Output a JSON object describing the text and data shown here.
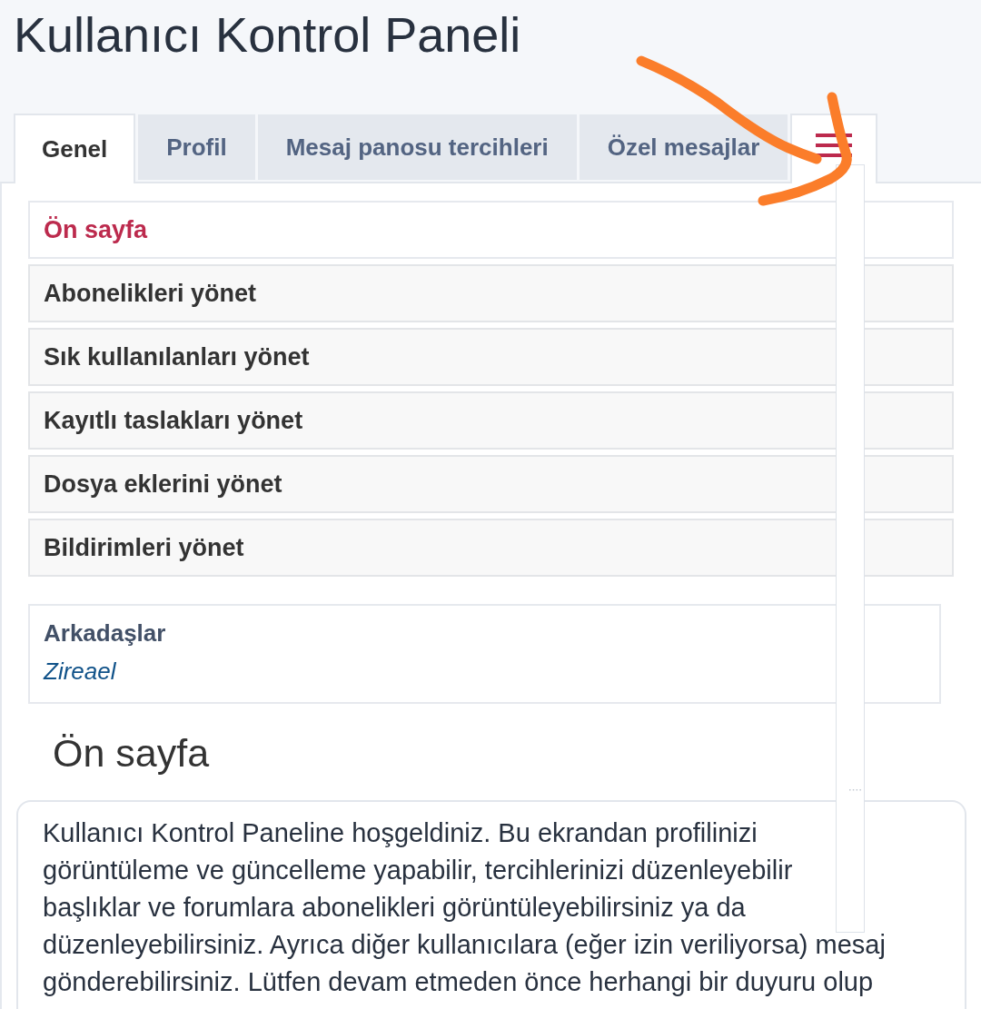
{
  "title": "Kullanıcı Kontrol Paneli",
  "tabs": [
    {
      "label": "Genel",
      "selected": true
    },
    {
      "label": "Profil",
      "selected": false
    },
    {
      "label": "Mesaj panosu tercihleri",
      "selected": false
    },
    {
      "label": "Özel mesajlar",
      "selected": false
    }
  ],
  "menu_tab": {
    "expanded": true
  },
  "nav": [
    {
      "label": "Ön sayfa",
      "selected": true
    },
    {
      "label": "Abonelikleri yönet",
      "selected": false
    },
    {
      "label": "Sık kullanılanları yönet",
      "selected": false
    },
    {
      "label": "Kayıtlı taslakları yönet",
      "selected": false
    },
    {
      "label": "Dosya eklerini yönet",
      "selected": false
    },
    {
      "label": "Bildirimleri yönet",
      "selected": false
    }
  ],
  "friends": {
    "title": "Arkadaşlar",
    "names": [
      "Zireael"
    ]
  },
  "heading": "Ön sayfa",
  "welcome_text": "Kullanıcı Kontrol Paneline hoşgeldiniz. Bu ekrandan profilinizi\ngörüntüleme ve güncelleme yapabilir, tercihlerinizi düzenleyebilir\nbaşlıklar ve forumlara abonelikleri görüntüleyebilirsiniz ya da\ndüzenleyebilirsiniz. Ayrıca diğer kullanıcılara (eğer izin veriliyorsa) mesaj\ngönderebilirsiniz. Lütfen devam etmeden önce herhangi bir duyuru olup"
}
